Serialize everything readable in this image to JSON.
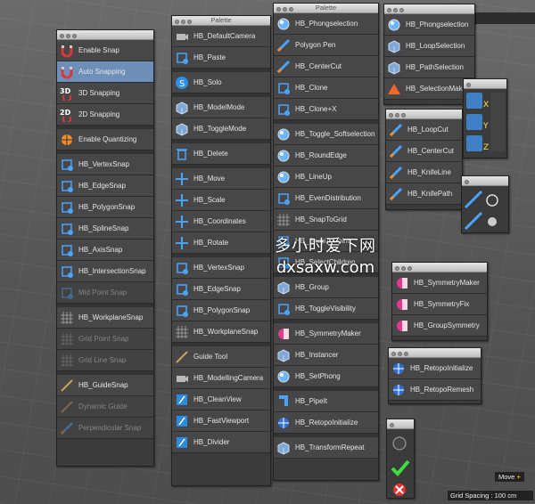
{
  "colors": {
    "accent": "#6e8fb8",
    "panel": "#3b3b3b",
    "item": "#474747"
  },
  "panels": {
    "snap": {
      "items": [
        {
          "label": "Enable Snap",
          "icon": "magnet-icon"
        },
        {
          "label": "Auto Snapping",
          "icon": "auto-snap-icon",
          "selected": true
        },
        {
          "label": "3D Snapping",
          "icon": "3d-snap-icon",
          "badge": "3D"
        },
        {
          "label": "2D Snapping",
          "icon": "2d-snap-icon",
          "badge": "2D"
        },
        {
          "label": "Enable Quantizing",
          "icon": "quantize-icon"
        },
        {
          "label": "HB_VertexSnap",
          "icon": "vertex-snap-icon"
        },
        {
          "label": "HB_EdgeSnap",
          "icon": "edge-snap-icon"
        },
        {
          "label": "HB_PolygonSnap",
          "icon": "polygon-snap-icon"
        },
        {
          "label": "HB_SplineSnap",
          "icon": "spline-snap-icon"
        },
        {
          "label": "HB_AxisSnap",
          "icon": "axis-snap-icon"
        },
        {
          "label": "HB_IntersectionSnap",
          "icon": "intersection-snap-icon"
        },
        {
          "label": "Mid Point Snap",
          "icon": "midpoint-snap-icon",
          "disabled": true
        },
        {
          "label": "HB_WorkplaneSnap",
          "icon": "workplane-snap-icon"
        },
        {
          "label": "Grid Point Snap",
          "icon": "grid-point-snap-icon",
          "disabled": true
        },
        {
          "label": "Grid Line Snap",
          "icon": "grid-line-snap-icon",
          "disabled": true
        },
        {
          "label": "HB_GuideSnap",
          "icon": "guide-snap-icon"
        },
        {
          "label": "Dynamic Guide",
          "icon": "dynamic-guide-icon",
          "disabled": true
        },
        {
          "label": "Perpendicular Snap",
          "icon": "perpendicular-snap-icon",
          "disabled": true
        }
      ]
    },
    "palette1": {
      "title": "Palette",
      "items": [
        {
          "label": "HB_DefaultCamera",
          "icon": "camera-icon"
        },
        {
          "label": "HB_Paste",
          "icon": "paste-icon"
        },
        {
          "label": "HB_Solo",
          "icon": "solo-icon"
        },
        {
          "label": "HB_ModelMode",
          "icon": "cube-icon"
        },
        {
          "label": "HB_ToggleMode",
          "icon": "toggle-mode-icon"
        },
        {
          "label": "HB_Delete",
          "icon": "trash-icon"
        },
        {
          "label": "HB_Move",
          "icon": "move-icon"
        },
        {
          "label": "HB_Scale",
          "icon": "scale-icon"
        },
        {
          "label": "HB_Coordinates",
          "icon": "coordinates-icon"
        },
        {
          "label": "HB_Rotate",
          "icon": "rotate-icon"
        },
        {
          "label": "HB_VertexSnap",
          "icon": "vertex-snap-icon"
        },
        {
          "label": "HB_EdgeSnap",
          "icon": "edge-snap-icon"
        },
        {
          "label": "HB_PolygonSnap",
          "icon": "polygon-snap-icon"
        },
        {
          "label": "HB_WorkplaneSnap",
          "icon": "workplane-snap-icon"
        },
        {
          "label": "Guide Tool",
          "icon": "guide-tool-icon"
        },
        {
          "label": "HB_ModellingCamera",
          "icon": "modelling-camera-icon"
        },
        {
          "label": "HB_CleanView",
          "icon": "clean-view-icon"
        },
        {
          "label": "HB_FastViewport",
          "icon": "fast-viewport-icon"
        },
        {
          "label": "HB_Divider",
          "icon": "divider-icon"
        }
      ]
    },
    "palette2": {
      "title": "Palette",
      "items": [
        {
          "label": "HB_Phongselection",
          "icon": "phong-icon"
        },
        {
          "label": "Polygon Pen",
          "icon": "polygon-pen-icon"
        },
        {
          "label": "HB_CenterCut",
          "icon": "center-cut-icon"
        },
        {
          "label": "HB_Clone",
          "icon": "clone-icon"
        },
        {
          "label": "HB_Clone+X",
          "icon": "clone-x-icon"
        },
        {
          "label": "HB_Toggle_Softselection",
          "icon": "soft-selection-icon"
        },
        {
          "label": "HB_RoundEdge",
          "icon": "round-edge-icon"
        },
        {
          "label": "HB_LineUp",
          "icon": "line-up-icon"
        },
        {
          "label": "HB_EvenDistribution",
          "icon": "even-distribution-icon"
        },
        {
          "label": "HB_SnapToGrid",
          "icon": "snap-grid-icon"
        },
        {
          "label": "HB_SnapToPoint",
          "icon": "snap-point-icon"
        },
        {
          "label": "HB_SelectChildren",
          "icon": "select-children-icon"
        },
        {
          "label": "HB_Group",
          "icon": "group-icon"
        },
        {
          "label": "HB_ToggleVisibility",
          "icon": "visibility-icon"
        },
        {
          "label": "HB_SymmetryMaker",
          "icon": "symmetry-icon"
        },
        {
          "label": "HB_Instancer",
          "icon": "instancer-icon"
        },
        {
          "label": "HB_SetPhong",
          "icon": "set-phong-icon"
        },
        {
          "label": "HB_PipeIt",
          "icon": "pipe-icon"
        },
        {
          "label": "HB_RetopoInitialize",
          "icon": "retopo-icon"
        },
        {
          "label": "HB_TransformRepeat",
          "icon": "transform-repeat-icon"
        }
      ]
    },
    "selection": {
      "items": [
        {
          "label": "HB_Phongselection",
          "icon": "phong-icon"
        },
        {
          "label": "HB_LoopSelection",
          "icon": "loop-selection-icon"
        },
        {
          "label": "HB_PathSelection",
          "icon": "path-selection-icon"
        },
        {
          "label": "HB_SelectionMaker",
          "icon": "selection-maker-icon"
        }
      ]
    },
    "cuts": {
      "items": [
        {
          "label": "HB_LoopCut",
          "icon": "loop-cut-icon"
        },
        {
          "label": "HB_CenterCut",
          "icon": "center-cut-icon"
        },
        {
          "label": "HB_KnifeLine",
          "icon": "knife-line-icon"
        },
        {
          "label": "HB_KnifePath",
          "icon": "knife-path-icon"
        }
      ]
    },
    "symmetry": {
      "items": [
        {
          "label": "HB_SymmetryMaker",
          "icon": "symmetry-icon"
        },
        {
          "label": "HB_SymmetryFix",
          "icon": "symmetry-fix-icon"
        },
        {
          "label": "HB_GroupSymmetry",
          "icon": "group-symmetry-icon"
        }
      ]
    },
    "retopo": {
      "items": [
        {
          "label": "HB_RetopoInitialize",
          "icon": "retopo-icon"
        },
        {
          "label": "HB_RetopoRemesh",
          "icon": "retopo-remesh-icon"
        }
      ]
    }
  },
  "status": {
    "move": "Move",
    "grid": "Grid Spacing : 100 cm"
  },
  "watermark": {
    "line1": "多小时爱下网",
    "line2": "dxsaxw.com"
  }
}
